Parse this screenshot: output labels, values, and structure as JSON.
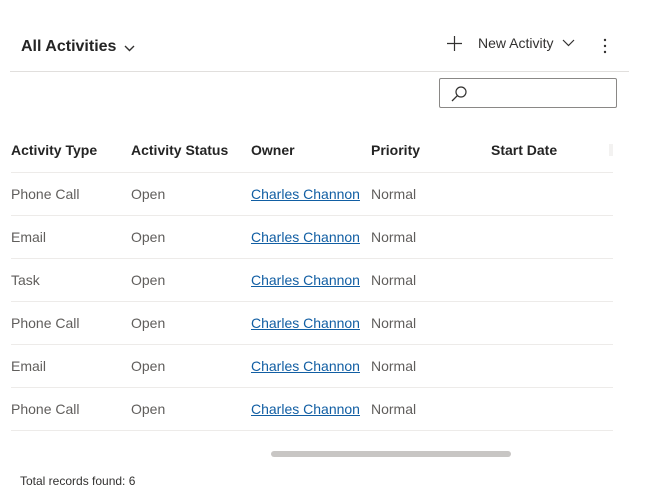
{
  "header": {
    "view_title": "All Activities",
    "new_label": "New Activity"
  },
  "search": {
    "placeholder": "",
    "value": ""
  },
  "grid": {
    "columns": [
      "Activity Type",
      "Activity Status",
      "Owner",
      "Priority",
      "Start Date"
    ],
    "rows": [
      {
        "type": "Phone Call",
        "status": "Open",
        "owner": "Charles Channon",
        "priority": "Normal",
        "start": ""
      },
      {
        "type": "Email",
        "status": "Open",
        "owner": "Charles Channon",
        "priority": "Normal",
        "start": ""
      },
      {
        "type": "Task",
        "status": "Open",
        "owner": "Charles Channon",
        "priority": "Normal",
        "start": ""
      },
      {
        "type": "Phone Call",
        "status": "Open",
        "owner": "Charles Channon",
        "priority": "Normal",
        "start": ""
      },
      {
        "type": "Email",
        "status": "Open",
        "owner": "Charles Channon",
        "priority": "Normal",
        "start": ""
      },
      {
        "type": "Phone Call",
        "status": "Open",
        "owner": "Charles Channon",
        "priority": "Normal",
        "start": ""
      }
    ]
  },
  "footer": {
    "records_text": "Total records found: 6"
  },
  "icons": {
    "view_chevron": "chevron-down-icon",
    "add": "plus-icon",
    "new_chevron": "chevron-down-icon",
    "more": "more-vertical-icon",
    "search": "search-icon"
  },
  "colors": {
    "link": "#115ea3",
    "text": "#323130",
    "muted_text": "#605e5c",
    "divider": "#edebe9",
    "scroll_thumb": "#c8c6c4"
  }
}
